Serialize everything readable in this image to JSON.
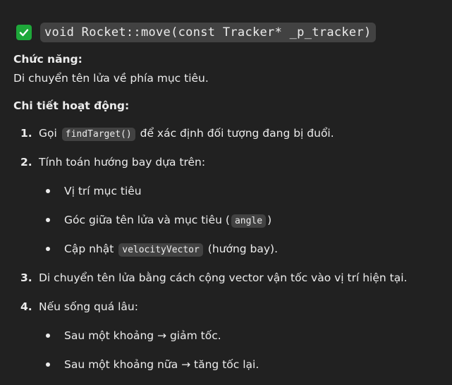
{
  "heading": {
    "icon": "check-mark-icon",
    "icon_color": "#1ea83a",
    "code": "void Rocket::move(const Tracker* _p_tracker)"
  },
  "function_section": {
    "label": "Chức năng:",
    "description": "Di chuyển tên lửa về phía mục tiêu."
  },
  "details_section": {
    "label": "Chi tiết hoạt động:"
  },
  "steps": [
    {
      "number": "1.",
      "prefix": "Gọi",
      "code": "findTarget()",
      "suffix": "để xác định đối tượng đang bị đuổi."
    },
    {
      "number": "2.",
      "text": "Tính toán hướng bay dựa trên:",
      "bullets": [
        {
          "text": "Vị trí mục tiêu"
        },
        {
          "prefix": "Góc giữa tên lửa và mục tiêu (",
          "code": "angle",
          "suffix": ")"
        },
        {
          "prefix": "Cập nhật",
          "code": "velocityVector",
          "suffix": "(hướng bay)."
        }
      ]
    },
    {
      "number": "3.",
      "text": "Di chuyển tên lửa bằng cách cộng vector vận tốc vào vị trí hiện tại."
    },
    {
      "number": "4.",
      "text": "Nếu sống quá lâu:",
      "bullets": [
        {
          "text": "Sau một khoảng → giảm tốc."
        },
        {
          "text": "Sau một khoảng nữa → tăng tốc lại."
        }
      ]
    }
  ]
}
